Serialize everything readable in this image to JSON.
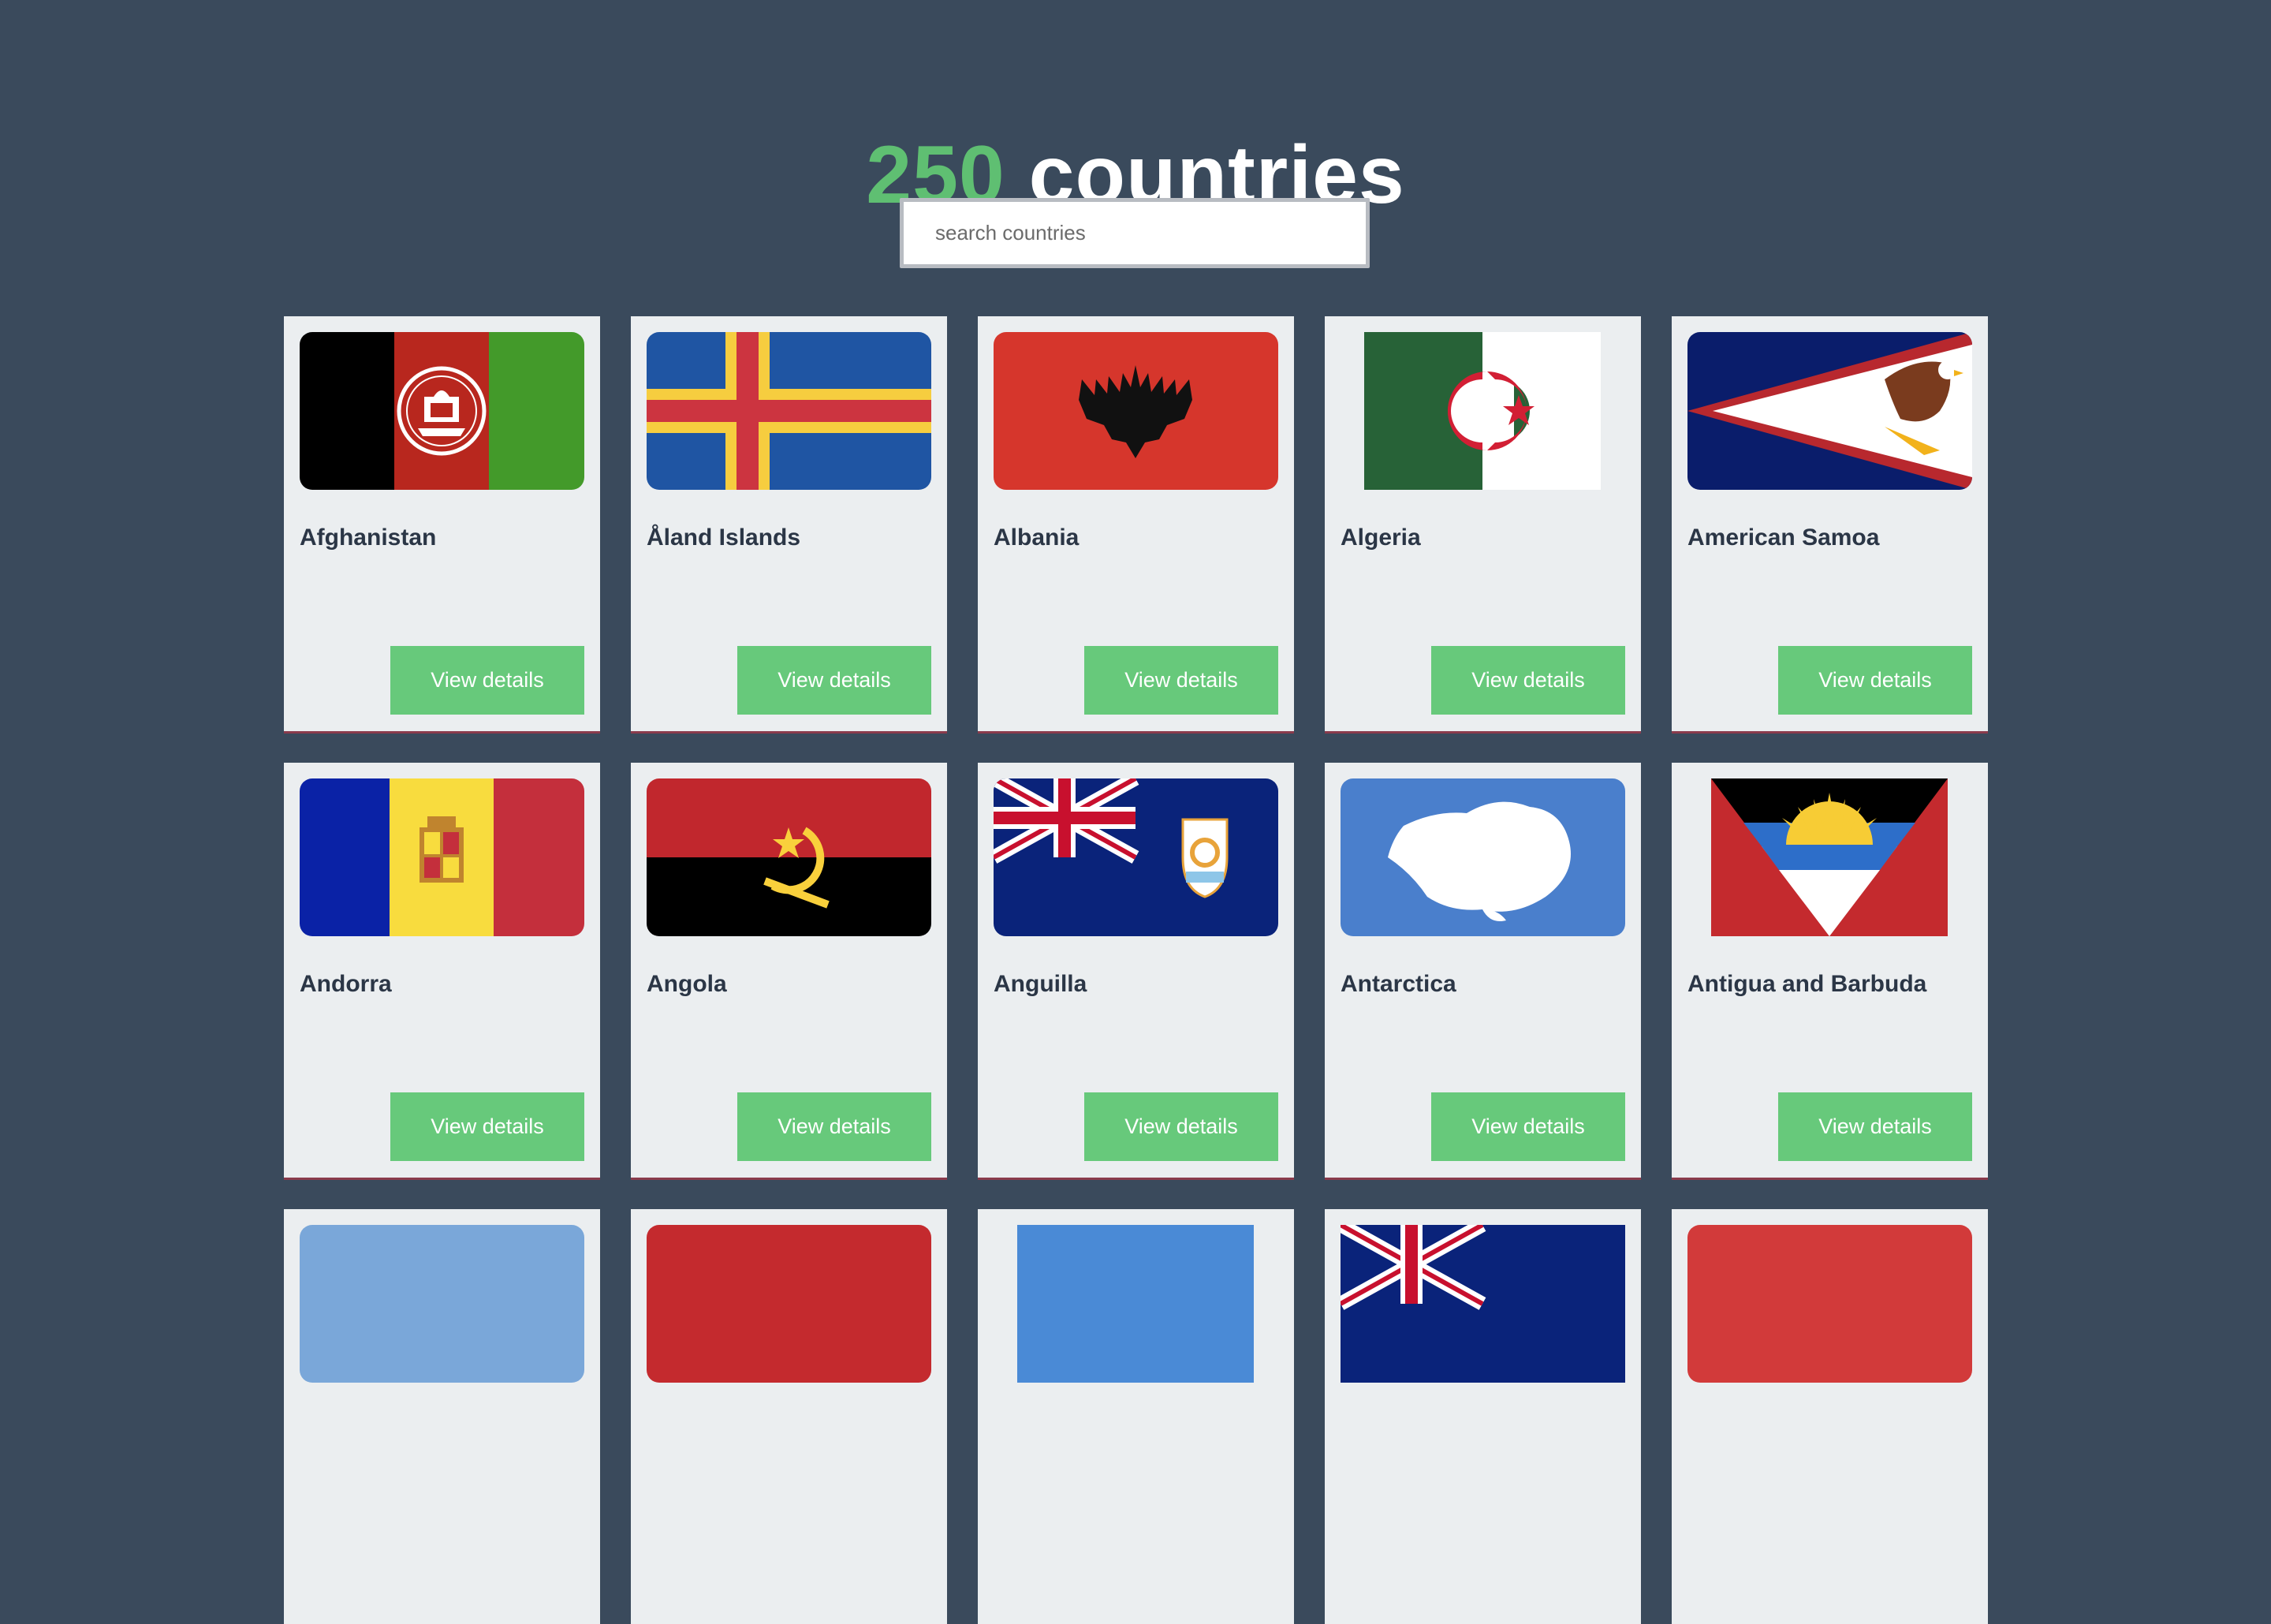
{
  "header": {
    "count": "250",
    "suffix": " countries"
  },
  "search": {
    "placeholder": "search countries",
    "value": ""
  },
  "button_label": "View details",
  "countries": [
    {
      "name": "Afghanistan",
      "flag": "afghanistan-flag"
    },
    {
      "name": "Åland Islands",
      "flag": "aland-islands-flag"
    },
    {
      "name": "Albania",
      "flag": "albania-flag"
    },
    {
      "name": "Algeria",
      "flag": "algeria-flag"
    },
    {
      "name": "American Samoa",
      "flag": "american-samoa-flag"
    },
    {
      "name": "Andorra",
      "flag": "andorra-flag"
    },
    {
      "name": "Angola",
      "flag": "angola-flag"
    },
    {
      "name": "Anguilla",
      "flag": "anguilla-flag"
    },
    {
      "name": "Antarctica",
      "flag": "antarctica-flag"
    },
    {
      "name": "Antigua and Barbuda",
      "flag": "antigua-and-barbuda-flag"
    }
  ],
  "colors": {
    "background": "#3a4a5c",
    "accent": "#5fbf72",
    "button": "#67c97b",
    "card": "#ebeef0",
    "text": "#2b3646"
  }
}
